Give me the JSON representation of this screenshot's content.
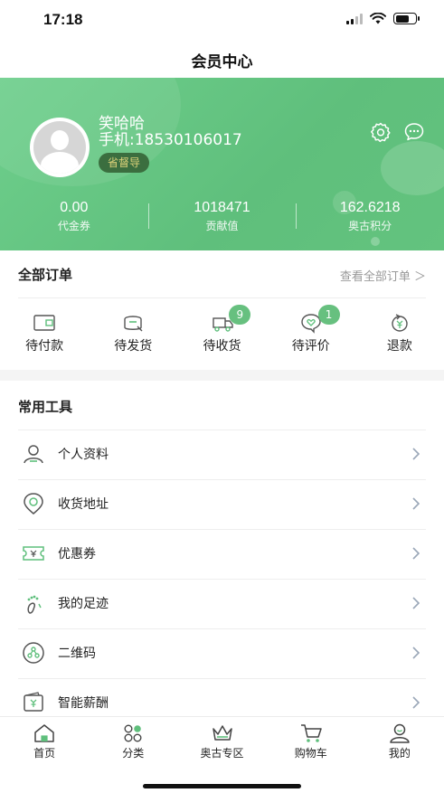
{
  "status_bar": {
    "time": "17:18"
  },
  "nav": {
    "title": "会员中心"
  },
  "profile": {
    "name": "笑哈哈",
    "phone": "手机:18530106017",
    "role": "省督导",
    "icons": [
      "gear-icon",
      "message-icon"
    ]
  },
  "stats": [
    {
      "value": "0.00",
      "label": "代金券"
    },
    {
      "value": "1018471",
      "label": "贡献值"
    },
    {
      "value": "162.6218",
      "label": "奥古积分"
    }
  ],
  "orders": {
    "title": "全部订单",
    "view_all": "查看全部订单 ＞",
    "items": [
      {
        "label": "待付款",
        "icon": "wallet-icon"
      },
      {
        "label": "待发货",
        "icon": "box-icon"
      },
      {
        "label": "待收货",
        "icon": "truck-icon",
        "badge": "9"
      },
      {
        "label": "待评价",
        "icon": "heart-comment-icon",
        "badge": "1"
      },
      {
        "label": "退款",
        "icon": "refund-icon"
      }
    ],
    "accent": "#67c07f"
  },
  "tools": {
    "title": "常用工具",
    "items": [
      {
        "label": "个人资料",
        "icon": "user-icon"
      },
      {
        "label": "收货地址",
        "icon": "location-icon"
      },
      {
        "label": "优惠券",
        "icon": "coupon-icon"
      },
      {
        "label": "我的足迹",
        "icon": "footprint-icon"
      },
      {
        "label": "二维码",
        "icon": "qrcode-icon"
      },
      {
        "label": "智能薪酬",
        "icon": "salary-wallet-icon"
      }
    ]
  },
  "tab_bar": {
    "tabs": [
      {
        "label": "首页",
        "icon": "home-icon"
      },
      {
        "label": "分类",
        "icon": "category-icon"
      },
      {
        "label": "奥古专区",
        "icon": "crown-icon"
      },
      {
        "label": "购物车",
        "icon": "cart-icon"
      },
      {
        "label": "我的",
        "icon": "profile-icon"
      }
    ]
  },
  "colors": {
    "brand_green": "#5fbf7c",
    "badge_bg": "#3b6e3f",
    "badge_text": "#dcd27a"
  }
}
